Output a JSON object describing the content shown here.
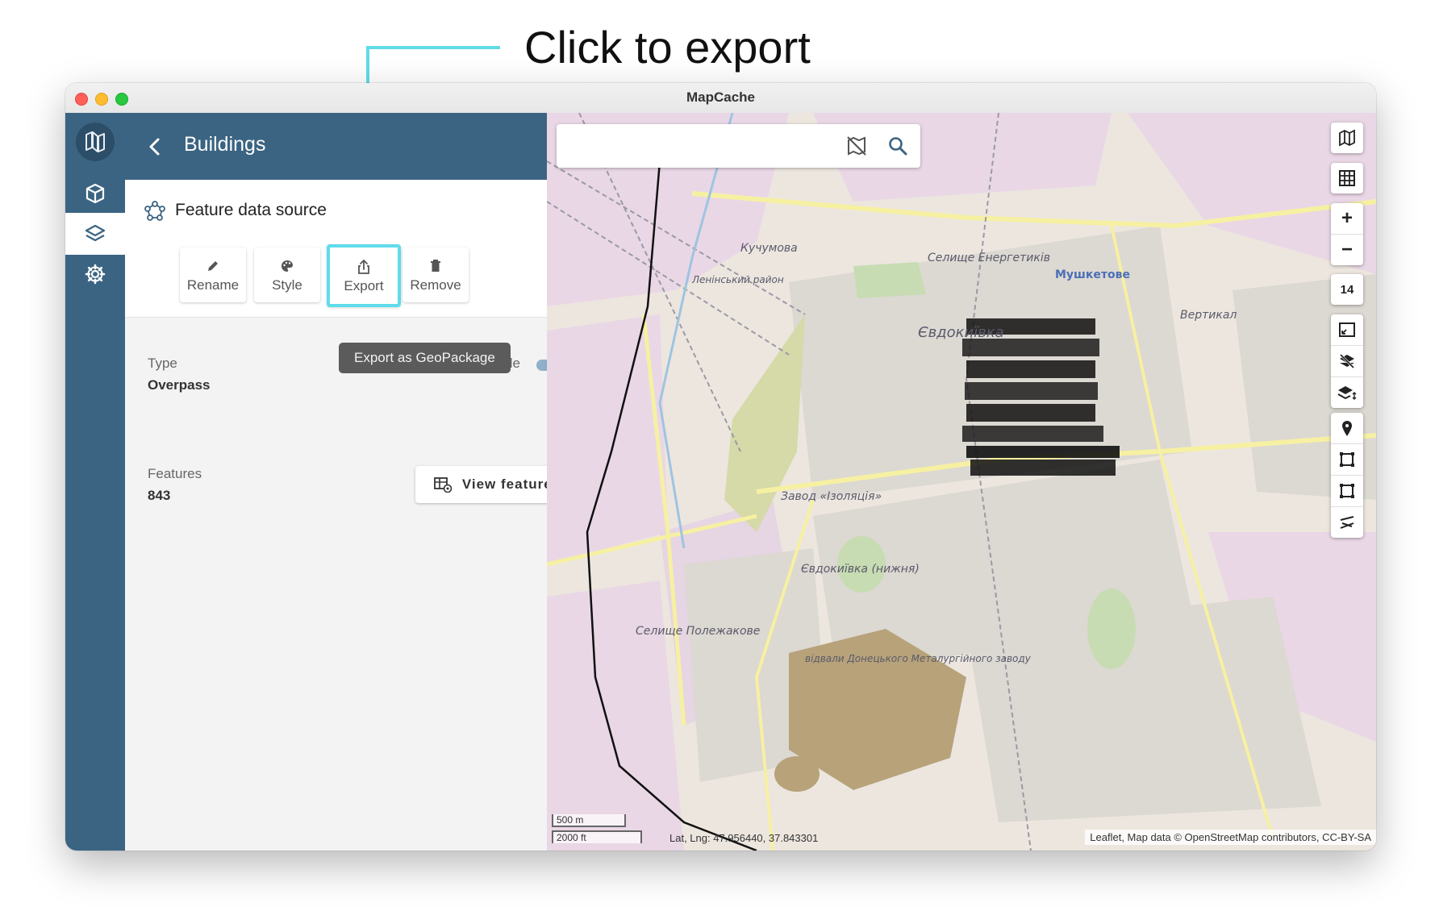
{
  "annotation": {
    "title": "Click to export"
  },
  "window": {
    "title": "MapCache"
  },
  "panel": {
    "title": "Buildings",
    "source_label": "Feature data source",
    "actions": {
      "rename": "Rename",
      "style": "Style",
      "export": "Export",
      "remove": "Remove"
    },
    "tooltip": "Export as GeoPackage",
    "type_label": "Type",
    "type_value": "Overpass",
    "enable_label": "Enable",
    "enabled": true,
    "features_label": "Features",
    "features_value": "843",
    "view_features": "View features"
  },
  "map": {
    "search_placeholder": "",
    "zoom_level": "14",
    "scale_metric": "500 m",
    "scale_imperial": "2000 ft",
    "latlng": "Lat, Lng: 47.956440, 37.843301",
    "attribution": "Leaflet, Map data © OpenStreetMap contributors, CC-BY-SA",
    "labels": [
      "Кучумова",
      "Селище Енергетиків",
      "Мушкетове",
      "Вертикал",
      "Євдокиївка",
      "Завод «Ізоляція»",
      "Євдокиївка (нижня)",
      "Селище Полежакове",
      "відвали Донецького Металургійного заводу",
      "Ленінський район"
    ],
    "colors": {
      "building": "#111111",
      "residential": "#dcd8d2",
      "industrial": "#e9d7e6",
      "park": "#c7dcb2",
      "woods": "#b7a27a",
      "road_major": "#f6f0a2",
      "highlight": "#5fdcea",
      "rail": "#3b6482"
    }
  }
}
